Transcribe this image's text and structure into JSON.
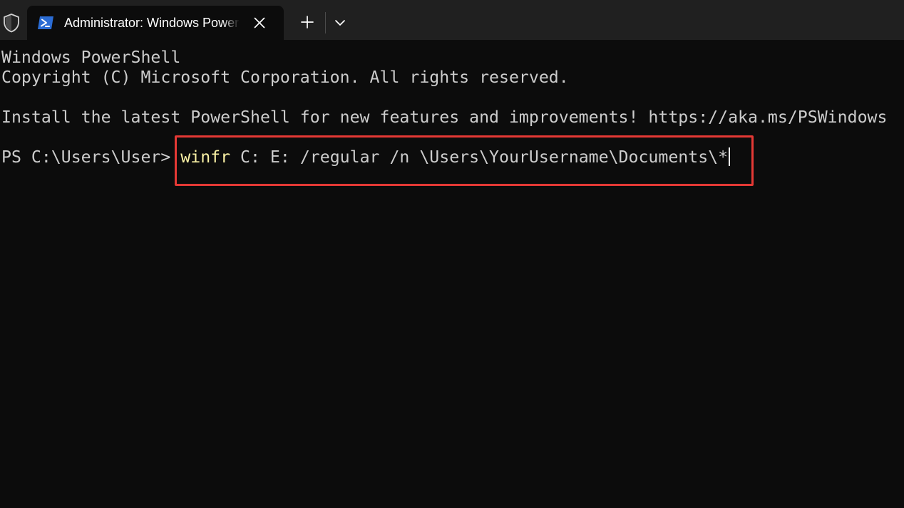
{
  "window": {
    "tab": {
      "title": "Administrator: Windows PowerShell",
      "icon": "powershell-icon"
    },
    "titlebar_icons": [
      "shield-icon",
      "close-icon",
      "plus-icon",
      "chevron-down-icon"
    ]
  },
  "terminal": {
    "line1": "Windows PowerShell",
    "line2": "Copyright (C) Microsoft Corporation. All rights reserved.",
    "line3": "Install the latest PowerShell for new features and improvements! https://aka.ms/PSWindows",
    "prompt": "PS C:\\Users\\User> ",
    "command_name": "winfr",
    "command_args": " C: E: /regular /n \\Users\\YourUsername\\Documents\\*"
  },
  "colors": {
    "background": "#0c0c0c",
    "titlebar": "#202020",
    "text": "#cccccc",
    "command": "#f9f1a5",
    "highlight_border": "#e53935",
    "ps_icon": "#2b6cd4"
  }
}
